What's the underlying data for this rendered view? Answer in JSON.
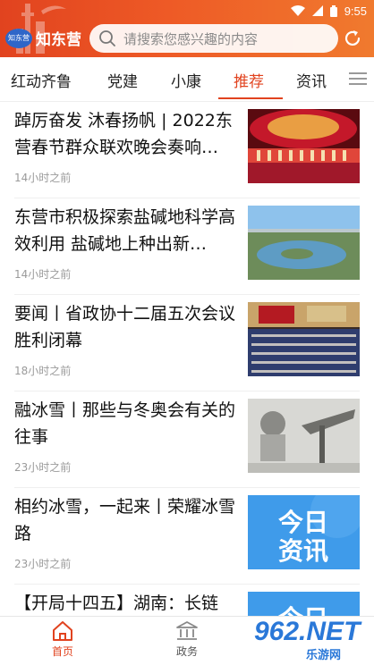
{
  "status": {
    "time": "9:55"
  },
  "header": {
    "logo_badge": "知东营",
    "logo_text": "知东营",
    "search_placeholder": "请搜索您感兴趣的内容"
  },
  "tabs": [
    {
      "label": "红动齐鲁",
      "active": false
    },
    {
      "label": "党建",
      "active": false
    },
    {
      "label": "小康",
      "active": false
    },
    {
      "label": "推荐",
      "active": true
    },
    {
      "label": "资讯",
      "active": false
    }
  ],
  "feed": [
    {
      "title": "踔厉奋发 沐春扬帆 | 2022东营春节群众联欢晚会奏响…",
      "time": "14小时之前",
      "thumb": "stage-performance"
    },
    {
      "title": "东营市积极探索盐碱地科学高效利用 盐碱地上种出新…",
      "time": "14小时之前",
      "thumb": "aerial-lake"
    },
    {
      "title": "要闻丨省政协十二届五次会议胜利闭幕",
      "time": "18小时之前",
      "thumb": "assembly-hall"
    },
    {
      "title": "融冰雪丨那些与冬奥会有关的往事",
      "time": "23小时之前",
      "thumb": "vintage-photo"
    },
    {
      "title": "相约冰雪，一起来丨荣耀冰雪路",
      "time": "23小时之前",
      "thumb": "today-news-card"
    },
    {
      "title": "【开局十四五】湖南：长链",
      "time": "",
      "thumb": "today-news-card"
    }
  ],
  "thumb_card_text": {
    "line1": "今日",
    "line2": "资讯"
  },
  "tabbar": [
    {
      "label": "首页",
      "active": true,
      "icon": "home-icon"
    },
    {
      "label": "政务",
      "active": false,
      "icon": "government-icon"
    }
  ],
  "watermark": {
    "number": "962.NET",
    "sub": "乐游网"
  },
  "colors": {
    "accent": "#e1431f",
    "header_end": "#f07a2e",
    "watermark": "#2a78d8"
  }
}
